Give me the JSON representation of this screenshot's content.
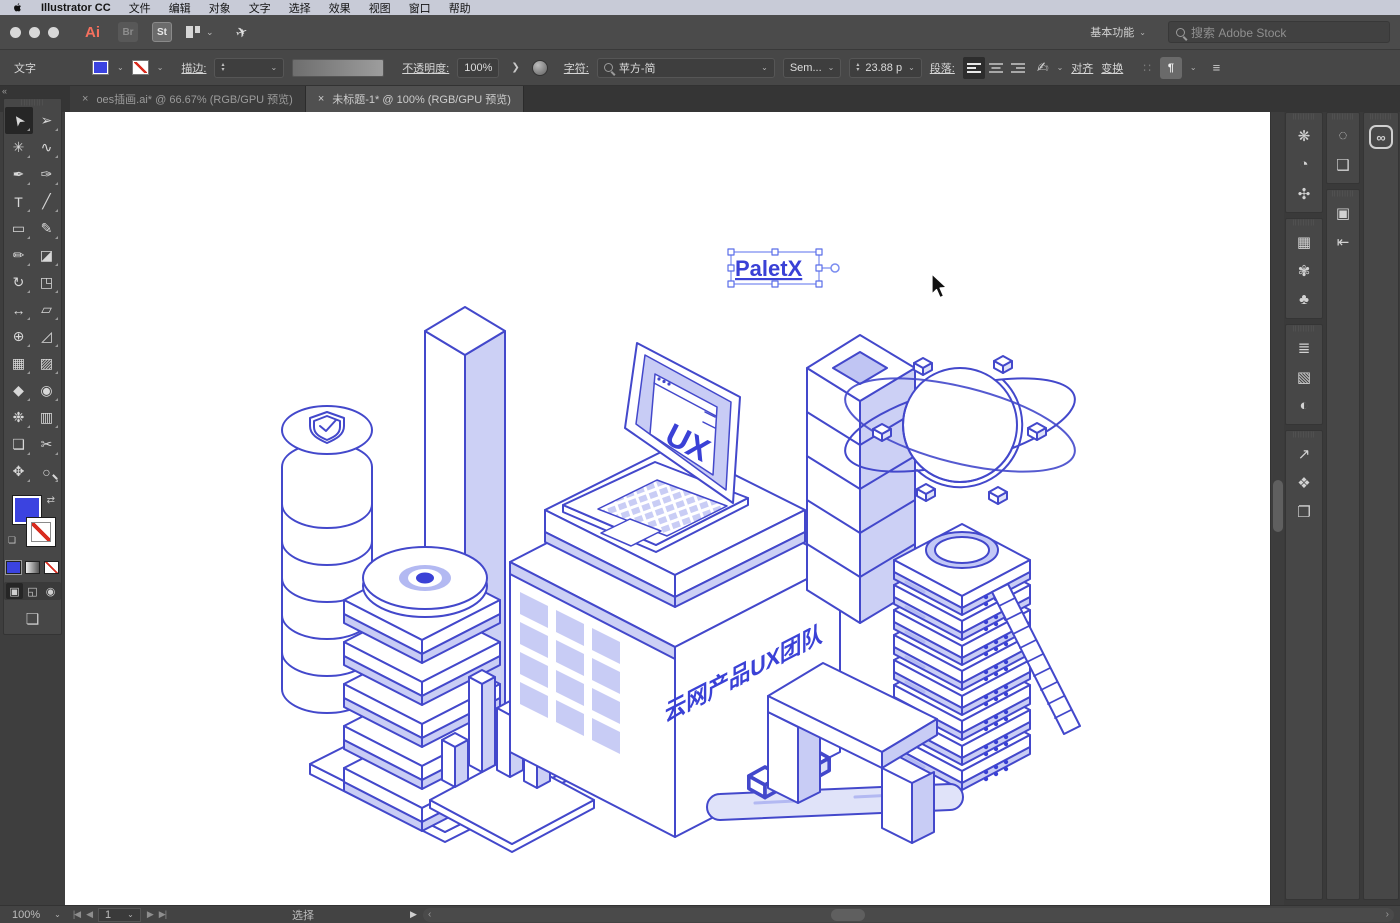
{
  "glyphs": {
    "collapse": "«",
    "chevron_down": "⌄",
    "chevron_up": "▴",
    "chevron_dn": "▾",
    "expand": "❯",
    "close": "×",
    "swap": "⇄",
    "minidef": "❏",
    "send": "✈",
    "dots4": "∷",
    "para_mark": "¶",
    "menu": "≡",
    "first": "|◀",
    "prev": "◀",
    "next": "▶",
    "last": "▶|",
    "left": "‹",
    "right": "›",
    "play": "▶",
    "cc": "∞",
    "board_chev": "⌄"
  },
  "menubar": {
    "app_name": "Illustrator CC",
    "items": [
      "文件",
      "编辑",
      "对象",
      "文字",
      "选择",
      "效果",
      "视图",
      "窗口",
      "帮助"
    ]
  },
  "appbar": {
    "ai": "Ai",
    "br": "Br",
    "st": "St",
    "workspace": "基本功能",
    "search_placeholder": "搜索 Adobe Stock"
  },
  "controlbar": {
    "context_label": "文字",
    "stroke_label": "描边:",
    "opacity_label": "不透明度:",
    "opacity_value": "100%",
    "char_label": "字符:",
    "font_name": "苹方-简",
    "font_style": "Sem...",
    "font_size": "23.88 p",
    "paragraph_label": "段落:",
    "align_label": "对齐",
    "transform_label": "变换"
  },
  "tabs": [
    {
      "close": "×",
      "label": "oes插画.ai* @ 66.67% (RGB/GPU 预览)"
    },
    {
      "close": "×",
      "label": "未标题-1* @ 100% (RGB/GPU 预览)"
    }
  ],
  "tools": [
    {
      "name": "selection-tool",
      "glyph": "➤",
      "active": true
    },
    {
      "name": "direct-selection-tool",
      "glyph": "➢"
    },
    {
      "name": "magic-wand-tool",
      "glyph": "✳"
    },
    {
      "name": "lasso-tool",
      "glyph": "∿"
    },
    {
      "name": "pen-tool",
      "glyph": "✒"
    },
    {
      "name": "curvature-tool",
      "glyph": "✑"
    },
    {
      "name": "type-tool",
      "glyph": "T"
    },
    {
      "name": "line-segment-tool",
      "glyph": "╱"
    },
    {
      "name": "rectangle-tool",
      "glyph": "▭"
    },
    {
      "name": "paintbrush-tool",
      "glyph": "✎"
    },
    {
      "name": "shaper-tool",
      "glyph": "✏"
    },
    {
      "name": "eraser-tool",
      "glyph": "◪"
    },
    {
      "name": "rotate-tool",
      "glyph": "↻"
    },
    {
      "name": "scale-tool",
      "glyph": "◳"
    },
    {
      "name": "width-tool",
      "glyph": "↔"
    },
    {
      "name": "free-transform-tool",
      "glyph": "▱"
    },
    {
      "name": "shape-builder-tool",
      "glyph": "⊕"
    },
    {
      "name": "perspective-grid-tool",
      "glyph": "◿"
    },
    {
      "name": "mesh-tool",
      "glyph": "▦"
    },
    {
      "name": "gradient-tool",
      "glyph": "▨"
    },
    {
      "name": "eyedropper-tool",
      "glyph": "◆"
    },
    {
      "name": "blend-tool",
      "glyph": "◉"
    },
    {
      "name": "symbol-sprayer-tool",
      "glyph": "❉"
    },
    {
      "name": "column-graph-tool",
      "glyph": "▥"
    },
    {
      "name": "artboard-tool",
      "glyph": "❏"
    },
    {
      "name": "slice-tool",
      "glyph": "✂"
    },
    {
      "name": "hand-tool",
      "glyph": "✥"
    },
    {
      "name": "zoom-tool",
      "glyph": "○"
    }
  ],
  "drawing_modes": [
    {
      "name": "draw-normal-mode",
      "glyph": "▣",
      "active": true
    },
    {
      "name": "draw-behind-mode",
      "glyph": "◱"
    },
    {
      "name": "draw-inside-mode",
      "glyph": "◉"
    }
  ],
  "right_panel": {
    "col1_group1": [
      {
        "name": "color-panel-icon",
        "glyph": "❋"
      },
      {
        "name": "color-guide-panel-icon",
        "glyph": "◔"
      },
      {
        "name": "recolor-artwork-icon",
        "glyph": "✣"
      }
    ],
    "col1_group2": [
      {
        "name": "swatches-panel-icon",
        "glyph": "▦"
      },
      {
        "name": "brushes-panel-icon",
        "glyph": "✾"
      },
      {
        "name": "symbols-panel-icon",
        "glyph": "♣"
      }
    ],
    "col1_group3": [
      {
        "name": "stroke-panel-icon",
        "glyph": "≣"
      },
      {
        "name": "gradient-panel-icon",
        "glyph": "▧"
      },
      {
        "name": "transparency-panel-icon",
        "glyph": "◐"
      }
    ],
    "col1_group4": [
      {
        "name": "asset-export-panel-icon",
        "glyph": "↗"
      },
      {
        "name": "layers-panel-icon",
        "glyph": "❖"
      },
      {
        "name": "artboards-panel-icon",
        "glyph": "❐"
      }
    ],
    "col2_group1": [
      {
        "name": "select-panel-icon",
        "glyph": "◌"
      },
      {
        "name": "pathfinder-panel-icon",
        "glyph": "❑"
      }
    ],
    "col2_group2": [
      {
        "name": "transform-panel-icon",
        "glyph": "▣"
      },
      {
        "name": "align-panel-icon",
        "glyph": "⇤"
      }
    ]
  },
  "canvas": {
    "selected_text": "PaletX",
    "laptop_screen_text": "UX",
    "box_text": "云网产品UX团队"
  },
  "statusbar": {
    "zoom": "100%",
    "page": "1",
    "status": "选择"
  },
  "colors": {
    "accent_blue": "#3b43e0",
    "line_blue": "#4348cb",
    "lavender": "#d6d9f7",
    "text_blue": "#3a41d6",
    "stroke_red": "#d92c1f"
  }
}
